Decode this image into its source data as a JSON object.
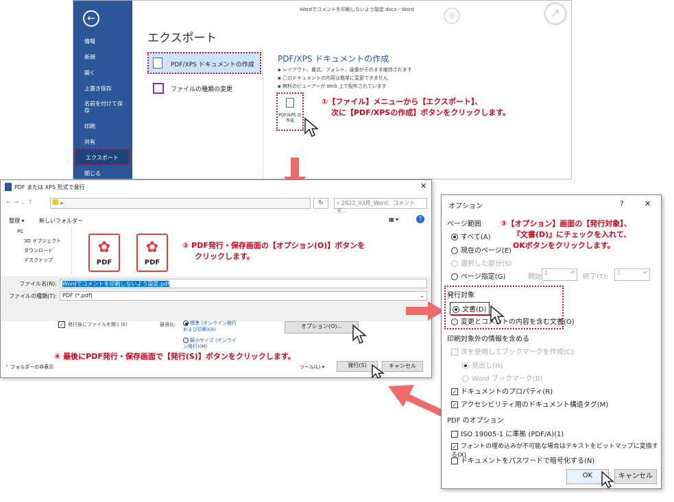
{
  "backstage": {
    "window_title": "Wordでコメントを印刷しないよう設定.docx - Word",
    "back_icon": "back-arrow-icon",
    "menu": [
      "情報",
      "新規",
      "開く",
      "上書き保存",
      "名前を付けて保存",
      "印刷",
      "共有",
      "エクスポート",
      "閉じる"
    ],
    "heading": "エクスポート",
    "option_pdf": "PDF/XPS ドキュメントの作成",
    "option_change": "ファイルの種類の変更",
    "section_title": "PDF/XPS ドキュメントの作成",
    "bullets": [
      "レイアウト、書式、フォント、画像がそのまま維持されます",
      "このドキュメントの内容は簡単に変更できません",
      "無料のビューアーが Web 上で配布されています"
    ],
    "create_button": "PDF/XPS の作成"
  },
  "annotations": {
    "step1_line1": "①【ファイル】メニューから【エクスポート】、",
    "step1_line2": "次に【PDF/XPSの作成】ボタンをクリックします。",
    "step2_line1": "② PDF発行・保存画面の【オプション(O)】ボタンを",
    "step2_line2": "クリックします。",
    "step3_line1": "③【オプション】画面の【発行対象】、",
    "step3_line2": "『文書(D)』にチェックを入れて、",
    "step3_line3": "OKボタンをクリックします。",
    "step4": "④ 最後にPDF発行・保存画面で【発行(S)】ボタンをクリックします。"
  },
  "save_dialog": {
    "title": "PDF または XPS 形式で発行",
    "search_placeholder": "2022_03月_Word：コメントを...",
    "organize": "整理 ▾",
    "new_folder": "新しいフォルダー",
    "tree": [
      "PC",
      "3D オブジェクト",
      "ダウンロード",
      "デスクトップ"
    ],
    "file_icon_label": "PDF",
    "filename_label": "ファイル名(N):",
    "filename_value": "Wordでコメントを印刷しないよう設定.pdf",
    "filetype_label": "ファイルの種類(T):",
    "filetype_value": "PDF (*.pdf)",
    "open_after": "発行後にファイルを開く(E)",
    "optimize_label": "最適化:",
    "opt_standard": "標準 (オンライン発行および印刷)(A)",
    "opt_min": "最小サイズ (オンライン発行)(M)",
    "options_button": "オプション(O)...",
    "hide_folders": "フォルダーの非表示",
    "tools": "ツール(L) ▾",
    "publish_button": "発行(S)",
    "cancel_button": "キャンセル"
  },
  "options_dialog": {
    "title": "オプション",
    "help": "?",
    "close": "✕",
    "page_range": "ページ範囲",
    "all": "すべて(A)",
    "current": "現在のページ(E)",
    "selection": "選択した部分(S)",
    "pages": "ページ指定(G)",
    "from": "開始(F):",
    "from_value": "1",
    "to": "終了(T):",
    "to_value": "1",
    "publish_target": "発行対象",
    "doc": "文書(D)",
    "doc_markup": "変更とコメントの内容を含む文書(O)",
    "nonprint": "印刷対象外の情報を含める",
    "bookmarks": "次を使用してブックマークを作成(C):",
    "headings": "見出し(H)",
    "word_bookmarks": "Word ブックマーク(B)",
    "properties": "ドキュメントのプロパティ(R)",
    "structure": "アクセシビリティ用のドキュメント構造タグ(M)",
    "pdf_options": "PDF のオプション",
    "iso": "ISO 19005-1 に準拠 (PDF/A)(1)",
    "bitmap": "フォントの埋め込みが不可能な場合はテキストをビットマップに変換する(X)",
    "encrypt": "ドキュメントをパスワードで暗号化する(N)",
    "ok": "OK",
    "cancel": "キャンセル"
  },
  "colors": {
    "word_blue": "#2b579a",
    "annotation_red": "#d0021b"
  }
}
